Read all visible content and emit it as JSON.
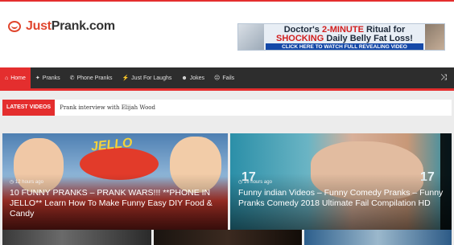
{
  "header": {
    "logo_part1": "Just",
    "logo_part2": "Prank.com"
  },
  "ad": {
    "line1_a": "Doctor's ",
    "line1_b": "2-MINUTE",
    "line1_c": " Ritual for",
    "line2_a": "SHOCKING",
    "line2_b": " Daily Belly Fat Loss!",
    "cta": "CLICK HERE TO WATCH FULL REVEALING VIDEO"
  },
  "nav": {
    "items": [
      {
        "icon": "⌂",
        "label": "Home"
      },
      {
        "icon": "✦",
        "label": "Pranks"
      },
      {
        "icon": "✆",
        "label": "Phone Pranks"
      },
      {
        "icon": "⚡",
        "label": "Just For Laughs"
      },
      {
        "icon": "☻",
        "label": "Jokes"
      },
      {
        "icon": "☹",
        "label": "Fails"
      }
    ],
    "random_icon": "⤨"
  },
  "ticker": {
    "label": "LATEST VIDEOS",
    "text": "Prank interview with Elijah Wood"
  },
  "slides": [
    {
      "meta": "◷ 12 hours ago",
      "title": "10 FUNNY PRANKS – PRANK WARS!!! **PHONE IN JELLO** Learn How To Make Funny Easy DIY Food & Candy",
      "overlay": "JELLO"
    },
    {
      "meta": "◷ 16 hours ago",
      "title": "Funny indian Videos – Funny Comedy Pranks – Funny Pranks Comedy 2018 Ultimate Fail Compilation HD",
      "overlay_left": "17",
      "overlay_right": "17"
    }
  ],
  "colors": {
    "accent": "#e42e2e",
    "nav_bg": "#2d2d2d"
  }
}
